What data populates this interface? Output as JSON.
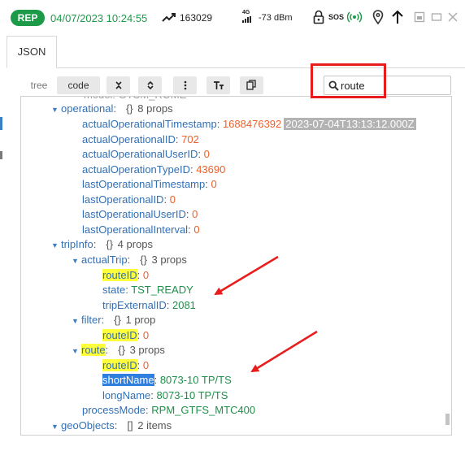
{
  "status": {
    "badge": "REP",
    "datetime": "04/07/2023 10:24:55",
    "count": "163029",
    "signal_tech": "4G",
    "signal": "-73 dBm",
    "sos": "SOS",
    "brand_green": "#1d9a48"
  },
  "tabs": [
    "JSON"
  ],
  "toolbar": {
    "modes": [
      "tree",
      "code"
    ],
    "buttons": [
      "sort-icon",
      "transform-icon",
      "more-icon",
      "text-icon",
      "copy-icon"
    ],
    "search_value": "route"
  },
  "tree": {
    "operational": {
      "key": "operational",
      "meta": "8 props",
      "rows": [
        {
          "key": "actualOperationalTimestamp",
          "value": "1688476392",
          "extra": "2023-07-04T13:13:12.000Z"
        },
        {
          "key": "actualOperationalID",
          "value": "702"
        },
        {
          "key": "actualOperationalUserID",
          "value": "0"
        },
        {
          "key": "actualOperationTypeID",
          "value": "43690"
        },
        {
          "key": "lastOperationalTimestamp",
          "value": "0"
        },
        {
          "key": "lastOperationalID",
          "value": "0"
        },
        {
          "key": "lastOperationalUserID",
          "value": "0"
        },
        {
          "key": "lastOperationalInterval",
          "value": "0"
        }
      ]
    },
    "tripInfo": {
      "key": "tripInfo",
      "meta": "4 props",
      "actualTrip": {
        "key": "actualTrip",
        "meta": "3 props",
        "routeID_key": "routeID",
        "routeID_value": "0",
        "state_key": "state",
        "state_value": "TST_READY",
        "tripExternalID_key": "tripExternalID",
        "tripExternalID_value": "2081"
      },
      "filter": {
        "key": "filter",
        "meta": "1 prop",
        "routeID_key": "routeID",
        "routeID_value": "0"
      },
      "route": {
        "key": "route",
        "meta": "3 props",
        "routeID_key": "routeID",
        "routeID_value": "0",
        "shortName_key": "shortName",
        "shortName_value": "8073-10 TP/TS",
        "longName_key": "longName",
        "longName_value": "8073-10 TP/TS"
      },
      "processMode_key": "processMode",
      "processMode_value": "RPM_GTFS_MTC400"
    },
    "geoObjects": {
      "key": "geoObjects",
      "meta": "2 items"
    }
  },
  "colors": {
    "highlight_yellow": "#ffff3c",
    "highlight_blue": "#2f7fe0",
    "annotation_red": "#e81c1c"
  }
}
